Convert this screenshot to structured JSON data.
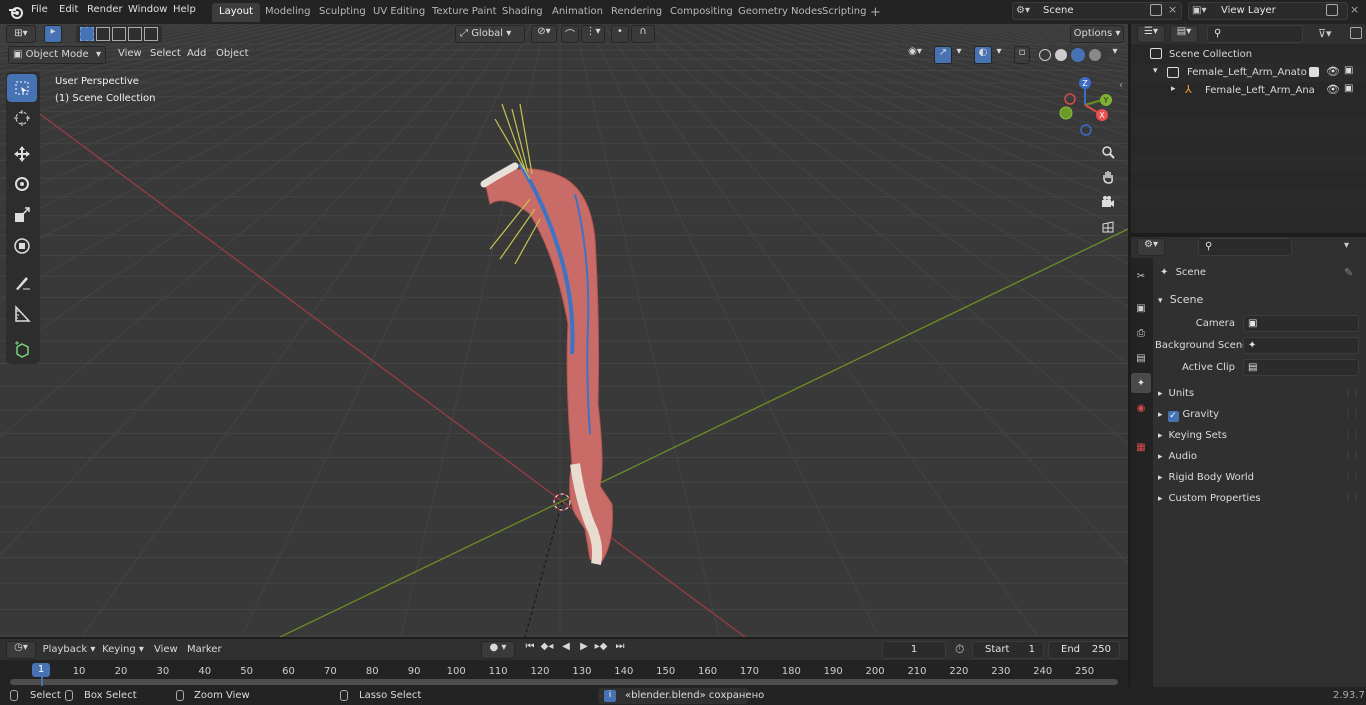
{
  "menus": [
    "File",
    "Edit",
    "Render",
    "Window",
    "Help"
  ],
  "workspaces": [
    "Layout",
    "Modeling",
    "Sculpting",
    "UV Editing",
    "Texture Paint",
    "Shading",
    "Animation",
    "Rendering",
    "Compositing",
    "Geometry Nodes",
    "Scripting"
  ],
  "active_workspace": "Layout",
  "scene_name": "Scene",
  "view_layer": "View Layer",
  "viewport": {
    "mode": "Object Mode",
    "menu": [
      "View",
      "Select",
      "Add",
      "Object"
    ],
    "transform": "Global",
    "options": "Options",
    "overlay_title": "User Perspective",
    "overlay_collection": "(1) Scene Collection",
    "gizmo_axes": {
      "x": "X",
      "y": "Y",
      "z": "Z"
    }
  },
  "outliner": {
    "root": "Scene Collection",
    "collection": "Female_Left_Arm_Anatomy_",
    "object": "Female_Left_Arm_Anato"
  },
  "properties": {
    "header": "Scene",
    "panel": "Scene",
    "fields": [
      {
        "label": "Camera",
        "value": ""
      },
      {
        "label": "Background Scene",
        "value": ""
      },
      {
        "label": "Active Clip",
        "value": ""
      }
    ],
    "sections": [
      "Units",
      "Gravity",
      "Keying Sets",
      "Audio",
      "Rigid Body World",
      "Custom Properties"
    ],
    "gravity_checked": true
  },
  "timeline": {
    "menu": [
      "Playback",
      "Keying",
      "View",
      "Marker"
    ],
    "current_frame": "1",
    "start_label": "Start",
    "start": "1",
    "end_label": "End",
    "end": "250",
    "ticks": [
      "1",
      "10",
      "20",
      "30",
      "40",
      "50",
      "60",
      "70",
      "80",
      "90",
      "100",
      "110",
      "120",
      "130",
      "140",
      "150",
      "160",
      "170",
      "180",
      "190",
      "200",
      "210",
      "220",
      "230",
      "240",
      "250"
    ]
  },
  "statusbar": {
    "select": "Select",
    "box_select": "Box Select",
    "zoom_view": "Zoom View",
    "lasso_select": "Lasso Select",
    "message": "«blender.blend» сохранено",
    "version": "2.93.7"
  },
  "colors": {
    "accent": "#4772b3",
    "x_axis": "#9b3a44",
    "y_axis": "#6b8e23",
    "viewport_bg": "#393939"
  }
}
